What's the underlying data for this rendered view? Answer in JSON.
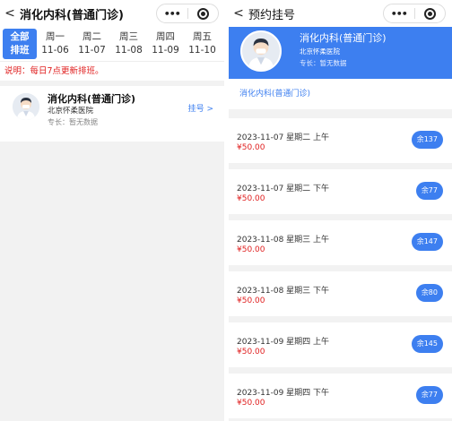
{
  "left": {
    "nav": {
      "back": "<",
      "title": "消化内科(普通门诊)",
      "more": "•••"
    },
    "days": [
      {
        "top": "全部",
        "bottom": "排班",
        "active": true
      },
      {
        "top": "周一",
        "bottom": "11-06"
      },
      {
        "top": "周二",
        "bottom": "11-07"
      },
      {
        "top": "周三",
        "bottom": "11-08"
      },
      {
        "top": "周四",
        "bottom": "11-09"
      },
      {
        "top": "周五",
        "bottom": "11-10"
      }
    ],
    "notice": "说明：每日7点更新排班。",
    "doctor": {
      "name": "消化内科(普通门诊)",
      "hospital": "北京怀柔医院",
      "specialty": "专长：暂无数据",
      "register_link": "挂号 >"
    }
  },
  "right": {
    "nav": {
      "back": "<",
      "title": "预约挂号",
      "more": "•••"
    },
    "doctor": {
      "name": "消化内科(普通门诊)",
      "hospital": "北京怀柔医院",
      "specialty": "专长：暂无数据"
    },
    "department": "消化内科(普通门诊)",
    "slots": [
      {
        "time": "2023-11-07 星期二 上午",
        "price": "¥50.00",
        "remain": "余137"
      },
      {
        "time": "2023-11-07 星期二 下午",
        "price": "¥50.00",
        "remain": "余77"
      },
      {
        "time": "2023-11-08 星期三 上午",
        "price": "¥50.00",
        "remain": "余147"
      },
      {
        "time": "2023-11-08 星期三 下午",
        "price": "¥50.00",
        "remain": "余80"
      },
      {
        "time": "2023-11-09 星期四 上午",
        "price": "¥50.00",
        "remain": "余145"
      },
      {
        "time": "2023-11-09 星期四 下午",
        "price": "¥50.00",
        "remain": "余77"
      }
    ]
  },
  "colors": {
    "accent": "#3d7ff0",
    "price": "#e02020",
    "background": "#f2f2f2"
  }
}
